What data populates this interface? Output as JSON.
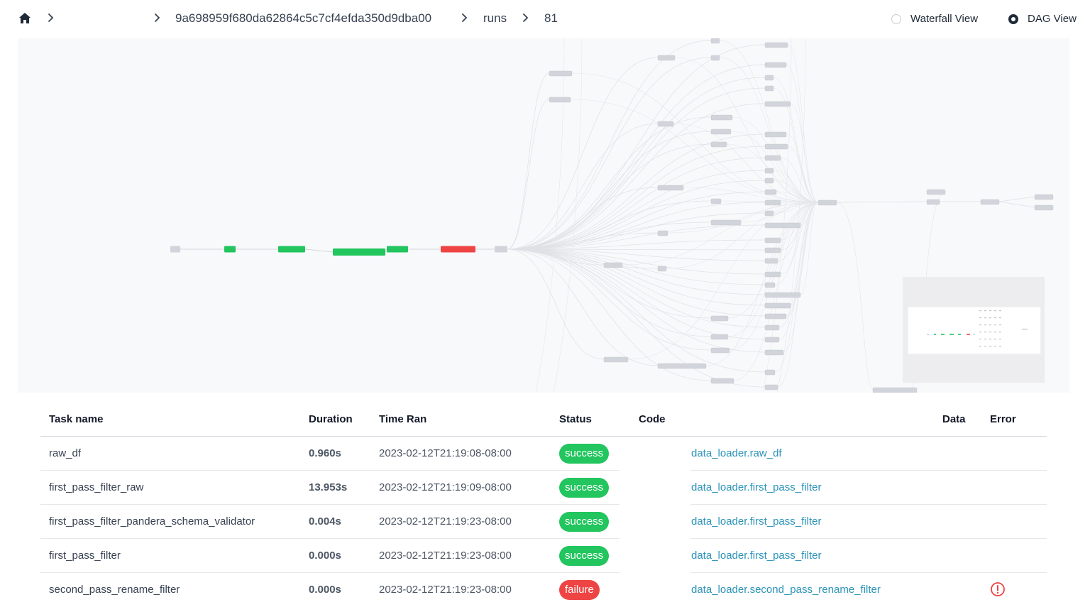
{
  "breadcrumb": {
    "items": [
      "9a698959f680da62864c5c7cf4efda350d9dba00",
      "runs",
      "81"
    ]
  },
  "view_toggle": {
    "options": [
      {
        "label": "Waterfall View",
        "selected": false
      },
      {
        "label": "DAG View",
        "selected": true
      }
    ]
  },
  "dag": {
    "colors": {
      "success": "#22c55e",
      "failure": "#ef4444",
      "pending": "#d1d5db"
    },
    "main_chain": [
      {
        "label": "",
        "status": "pending"
      },
      {
        "label": "raw_df",
        "status": "success"
      },
      {
        "label": "first_pass_filter_raw",
        "status": "success"
      },
      {
        "label": "first_pass_filter_pandera_schema_validator",
        "status": "success"
      },
      {
        "label": "first_pass_filter",
        "status": "success"
      },
      {
        "label": "second_pass_rename_filter",
        "status": "failure"
      },
      {
        "label": "",
        "status": "pending"
      }
    ]
  },
  "table": {
    "headers": {
      "task": "Task name",
      "duration": "Duration",
      "time": "Time Ran",
      "status": "Status",
      "code": "Code",
      "data": "Data",
      "error": "Error"
    },
    "rows": [
      {
        "task": "raw_df",
        "duration": "0.960s",
        "time": "2023-02-12T21:19:08-08:00",
        "status": "success",
        "code": "data_loader.raw_df",
        "error": false
      },
      {
        "task": "first_pass_filter_raw",
        "duration": "13.953s",
        "time": "2023-02-12T21:19:09-08:00",
        "status": "success",
        "code": "data_loader.first_pass_filter",
        "error": false
      },
      {
        "task": "first_pass_filter_pandera_schema_validator",
        "duration": "0.004s",
        "time": "2023-02-12T21:19:23-08:00",
        "status": "success",
        "code": "data_loader.first_pass_filter",
        "error": false
      },
      {
        "task": "first_pass_filter",
        "duration": "0.000s",
        "time": "2023-02-12T21:19:23-08:00",
        "status": "success",
        "code": "data_loader.first_pass_filter",
        "error": false
      },
      {
        "task": "second_pass_rename_filter",
        "duration": "0.000s",
        "time": "2023-02-12T21:19:23-08:00",
        "status": "failure",
        "code": "data_loader.second_pass_rename_filter",
        "error": true
      }
    ]
  }
}
